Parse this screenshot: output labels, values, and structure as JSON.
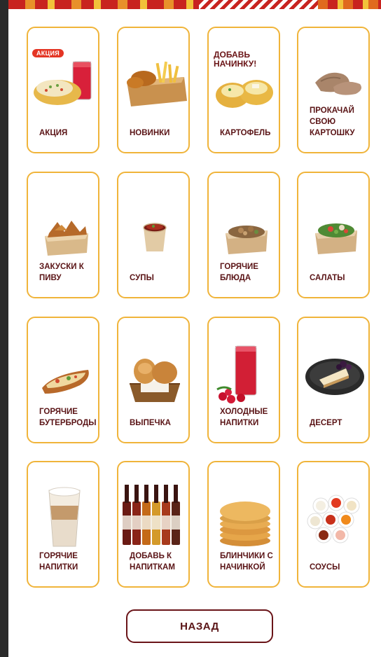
{
  "menu": {
    "categories": [
      {
        "label": "Акция",
        "badge": "Акция",
        "icon": "potato-drink-icon"
      },
      {
        "label": "Новинки",
        "icon": "chicken-fries-box-icon"
      },
      {
        "label": "Картофель",
        "promo": "Добавь начинку!",
        "icon": "stuffed-potato-icon"
      },
      {
        "label": "Прокачай свою картошку",
        "icon": "meat-topping-icon"
      },
      {
        "label": "Закуски к пиву",
        "icon": "snack-box-icon"
      },
      {
        "label": "Супы",
        "icon": "soup-cup-icon"
      },
      {
        "label": "Горячие блюда",
        "icon": "hot-dish-box-icon"
      },
      {
        "label": "Салаты",
        "icon": "salad-box-icon"
      },
      {
        "label": "Горячие бутерброды",
        "icon": "hot-sandwich-icon"
      },
      {
        "label": "Выпечка",
        "icon": "pastry-basket-icon"
      },
      {
        "label": "Холодные напитки",
        "icon": "berry-drink-icon"
      },
      {
        "label": "Десерт",
        "icon": "cheesecake-icon"
      },
      {
        "label": "Горячие напитки",
        "icon": "latte-glass-icon"
      },
      {
        "label": "Добавь к напиткам",
        "icon": "syrup-bottles-icon"
      },
      {
        "label": "Блинчики с начинкой",
        "icon": "pancake-stack-icon"
      },
      {
        "label": "Соусы",
        "icon": "sauce-bowls-icon"
      }
    ]
  },
  "footer": {
    "back_label": "НАЗАД"
  },
  "colors": {
    "accent_border": "#f0b43a",
    "text": "#5a1416",
    "badge": "#e43524"
  }
}
